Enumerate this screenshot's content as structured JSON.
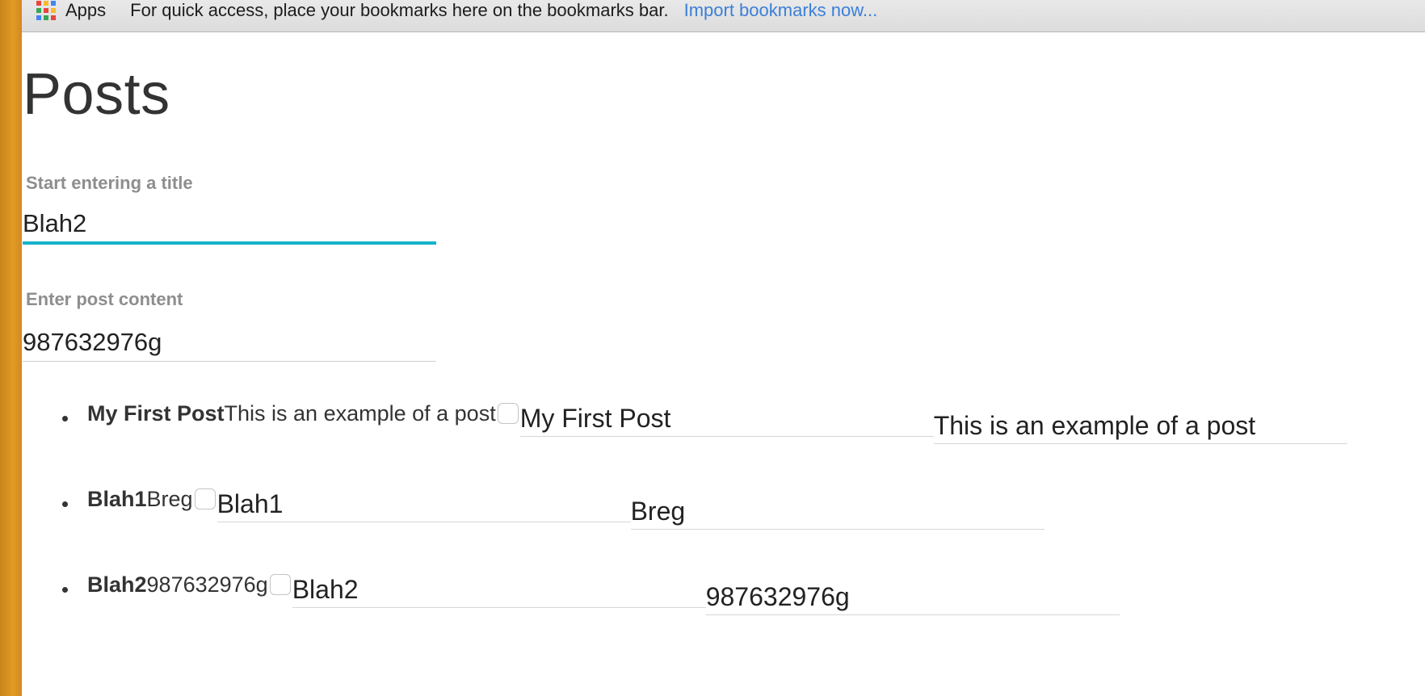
{
  "bookmarks_bar": {
    "apps_label": "Apps",
    "hint": "For quick access, place your bookmarks here on the bookmarks bar.",
    "import_link": "Import bookmarks now...",
    "apps_icon_colors": [
      "#e8453c",
      "#f9bb2d",
      "#4285f4",
      "#34a853",
      "#e8453c",
      "#f9bb2d",
      "#4285f4",
      "#34a853",
      "#e8453c"
    ]
  },
  "page": {
    "title": "Posts"
  },
  "form": {
    "title_label": "Start entering a title",
    "title_value": "Blah2",
    "content_label": "Enter post content",
    "content_value": "987632976g"
  },
  "posts": [
    {
      "title": "My First Post",
      "content": "This is an example of a post",
      "edit_title": "My First Post",
      "edit_content": "This is an example of a post"
    },
    {
      "title": "Blah1",
      "content": "Breg",
      "edit_title": "Blah1",
      "edit_content": "Breg"
    },
    {
      "title": "Blah2",
      "content": "987632976g",
      "edit_title": "Blah2",
      "edit_content": "987632976g"
    }
  ],
  "colors": {
    "accent": "#14b3cc",
    "link": "#3b7fd8",
    "side_strip": "#e29a26"
  }
}
